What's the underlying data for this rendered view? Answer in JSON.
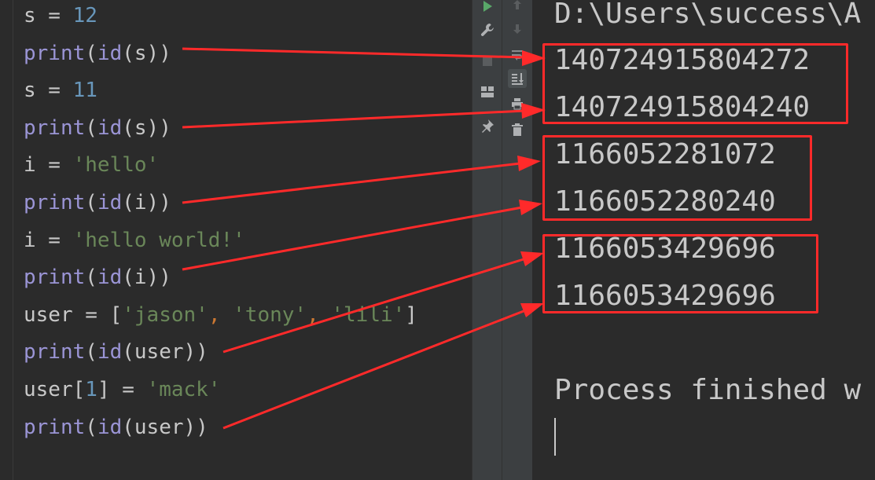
{
  "editor": {
    "lines": [
      [
        {
          "t": "s",
          "c": "var"
        },
        {
          "t": " = ",
          "c": "op"
        },
        {
          "t": "12",
          "c": "num"
        }
      ],
      [
        {
          "t": "print",
          "c": "fn"
        },
        {
          "t": "(",
          "c": "op"
        },
        {
          "t": "id",
          "c": "fn"
        },
        {
          "t": "(s))",
          "c": "op"
        }
      ],
      [
        {
          "t": "s",
          "c": "var"
        },
        {
          "t": " = ",
          "c": "op"
        },
        {
          "t": "11",
          "c": "num"
        }
      ],
      [
        {
          "t": "print",
          "c": "fn"
        },
        {
          "t": "(",
          "c": "op"
        },
        {
          "t": "id",
          "c": "fn"
        },
        {
          "t": "(s))",
          "c": "op"
        }
      ],
      [
        {
          "t": "i",
          "c": "var"
        },
        {
          "t": " = ",
          "c": "op"
        },
        {
          "t": "'hello'",
          "c": "str"
        }
      ],
      [
        {
          "t": "print",
          "c": "fn"
        },
        {
          "t": "(",
          "c": "op"
        },
        {
          "t": "id",
          "c": "fn"
        },
        {
          "t": "(i))",
          "c": "op"
        }
      ],
      [
        {
          "t": "i",
          "c": "var"
        },
        {
          "t": " = ",
          "c": "op"
        },
        {
          "t": "'hello world!'",
          "c": "str"
        }
      ],
      [
        {
          "t": "print",
          "c": "fn"
        },
        {
          "t": "(",
          "c": "op"
        },
        {
          "t": "id",
          "c": "fn"
        },
        {
          "t": "(i))",
          "c": "op"
        }
      ],
      [
        {
          "t": "user",
          "c": "var"
        },
        {
          "t": " = [",
          "c": "op"
        },
        {
          "t": "'jason'",
          "c": "str"
        },
        {
          "t": ", ",
          "c": "punc"
        },
        {
          "t": "'tony'",
          "c": "str"
        },
        {
          "t": ", ",
          "c": "punc"
        },
        {
          "t": "'lili'",
          "c": "str"
        },
        {
          "t": "]",
          "c": "op"
        }
      ],
      [
        {
          "t": "print",
          "c": "fn"
        },
        {
          "t": "(",
          "c": "op"
        },
        {
          "t": "id",
          "c": "fn"
        },
        {
          "t": "(user))",
          "c": "op"
        }
      ],
      [
        {
          "t": "user[",
          "c": "var"
        },
        {
          "t": "1",
          "c": "num"
        },
        {
          "t": "] = ",
          "c": "op"
        },
        {
          "t": "'mack'",
          "c": "str"
        }
      ],
      [
        {
          "t": "print",
          "c": "fn"
        },
        {
          "t": "(",
          "c": "op"
        },
        {
          "t": "id",
          "c": "fn"
        },
        {
          "t": "(user))",
          "c": "op"
        }
      ]
    ]
  },
  "toolbar": {
    "run_icon": "play-icon",
    "wrench_icon": "wrench-icon",
    "stop_icon": "stop-icon",
    "layout_icon": "layout-icon",
    "pin_icon": "pin-icon",
    "up_icon": "arrow-up-icon",
    "down_icon": "arrow-down-icon",
    "soft_wrap_icon": "soft-wrap-icon",
    "scroll_end_icon": "scroll-to-end-icon",
    "print_icon": "print-icon",
    "trash_icon": "trash-icon"
  },
  "console": {
    "path_line": "D:\\Users\\success\\A",
    "outputs": [
      "140724915804272",
      "140724915804240",
      "1166052281072",
      "1166052280240",
      "1166053429696",
      "1166053429696"
    ],
    "process_line": "Process finished w"
  },
  "colors": {
    "annotation": "#ff2a2a",
    "editor_bg": "#2b2b2b",
    "toolbar_bg": "#3c3f41",
    "run_green": "#59a869"
  }
}
